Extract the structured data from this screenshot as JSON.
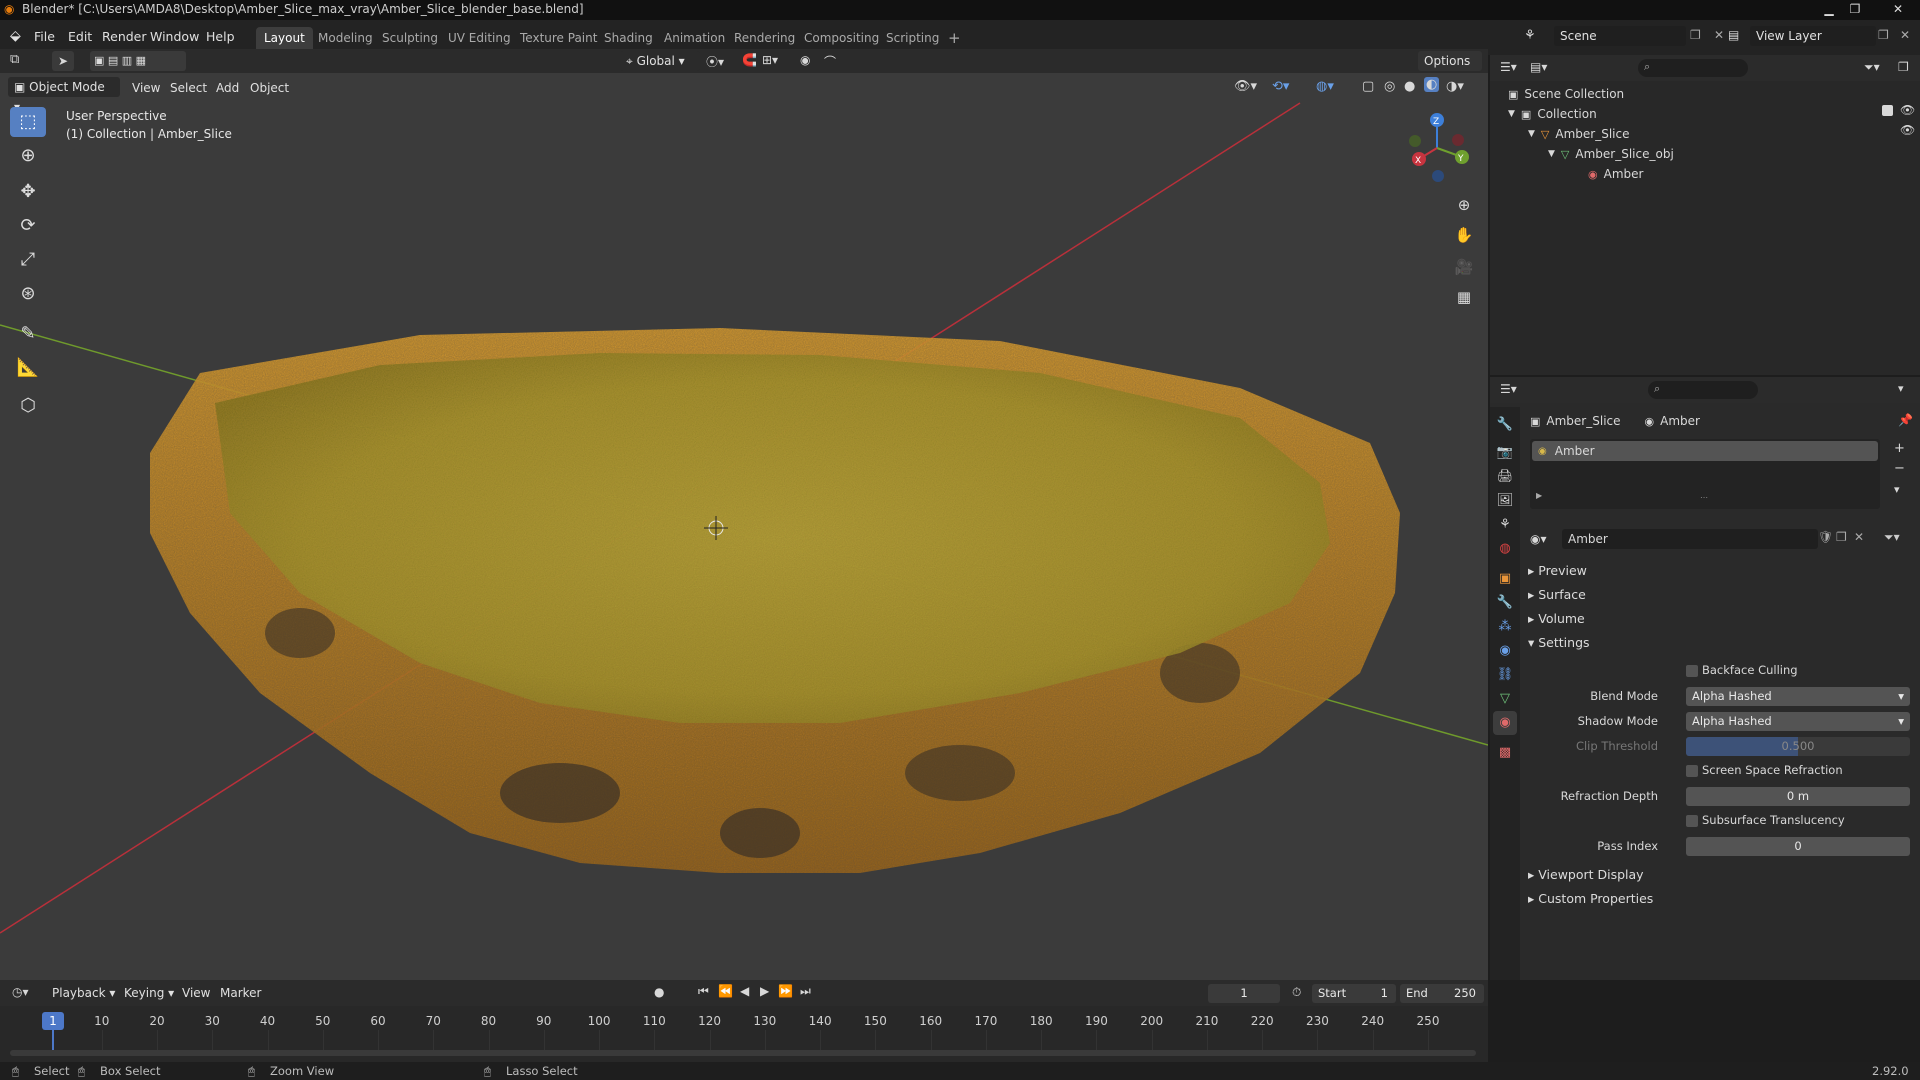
{
  "window": {
    "title": "Blender* [C:\\Users\\AMDA8\\Desktop\\Amber_Slice_max_vray\\Amber_Slice_blender_base.blend]"
  },
  "menu": [
    "File",
    "Edit",
    "Render",
    "Window",
    "Help"
  ],
  "workspaces": [
    "Layout",
    "Modeling",
    "Sculpting",
    "UV Editing",
    "Texture Paint",
    "Shading",
    "Animation",
    "Rendering",
    "Compositing",
    "Scripting"
  ],
  "scene": {
    "name": "Scene",
    "view_layer": "View Layer"
  },
  "toolbar": {
    "orientation": "Global",
    "options": "Options"
  },
  "viewport": {
    "mode": "Object Mode",
    "menus": [
      "View",
      "Select",
      "Add",
      "Object"
    ],
    "overlay_title": "User Perspective",
    "overlay_collection": "(1) Collection | Amber_Slice",
    "gizmo": {
      "x": "X",
      "y": "Y",
      "z": "Z"
    },
    "colors": {
      "background": "#3b3b3b",
      "x_axis": "#b8303a",
      "y_axis": "#6f9a2c",
      "amber": "#c8a43a"
    }
  },
  "outliner": {
    "root": "Scene Collection",
    "collection": "Collection",
    "object": "Amber_Slice",
    "mesh": "Amber_Slice_obj",
    "material": "Amber"
  },
  "properties": {
    "object": "Amber_Slice",
    "material": "Amber",
    "slot": "Amber",
    "material_name": "Amber",
    "sections": {
      "preview": "Preview",
      "surface": "Surface",
      "volume": "Volume",
      "settings": "Settings",
      "viewport_display": "Viewport Display",
      "custom_properties": "Custom Properties"
    },
    "settings": {
      "backface_culling": "Backface Culling",
      "blend_mode_label": "Blend Mode",
      "blend_mode": "Alpha Hashed",
      "shadow_mode_label": "Shadow Mode",
      "shadow_mode": "Alpha Hashed",
      "clip_threshold_label": "Clip Threshold",
      "clip_threshold": "0.500",
      "screen_space_refraction": "Screen Space Refraction",
      "refraction_depth_label": "Refraction Depth",
      "refraction_depth": "0 m",
      "subsurface_translucency": "Subsurface Translucency",
      "pass_index_label": "Pass Index",
      "pass_index": "0"
    }
  },
  "timeline": {
    "menus": [
      "Playback",
      "Keying",
      "View",
      "Marker"
    ],
    "current_frame": "1",
    "start_label": "Start",
    "start": "1",
    "end_label": "End",
    "end": "250",
    "playhead_label": "1",
    "ticks": [
      "10",
      "20",
      "30",
      "40",
      "50",
      "60",
      "70",
      "80",
      "90",
      "100",
      "110",
      "120",
      "130",
      "140",
      "150",
      "160",
      "170",
      "180",
      "190",
      "200",
      "210",
      "220",
      "230",
      "240",
      "250"
    ]
  },
  "status": {
    "select": "Select",
    "box_select": "Box Select",
    "zoom_view": "Zoom View",
    "lasso_select": "Lasso Select",
    "version": "2.92.0"
  }
}
